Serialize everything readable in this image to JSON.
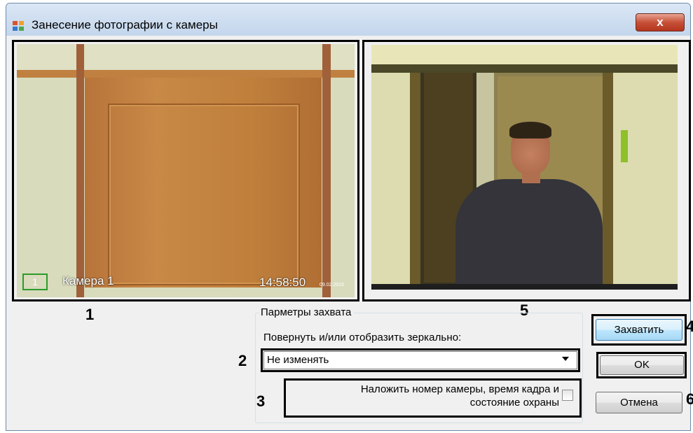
{
  "page": {
    "caption_fragment": ""
  },
  "window": {
    "title": "Занесение фотографии с камеры",
    "close_label": "x"
  },
  "left_camera": {
    "number": "1",
    "name": "Камера 1",
    "time": "14:58:50",
    "date": "09.02.2015"
  },
  "callouts": {
    "n1": "1",
    "n2": "2",
    "n3": "3",
    "n4": "4",
    "n5": "5",
    "n6": "6"
  },
  "capture_params": {
    "title": "Парметры захвата",
    "rotate_label": "Повернуть и/или отобразить зеркально:",
    "rotate_value": "Не изменять",
    "overlay_label_line1": "Наложить номер камеры, время кадра и",
    "overlay_label_line2": "состояние охраны",
    "overlay_checked": false
  },
  "buttons": {
    "capture": "Захватить",
    "ok": "OK",
    "cancel": "Отмена"
  },
  "colors": {
    "title_bar": "#c4d6ec",
    "close_button": "#c75038",
    "highlight_border": "#000000",
    "osd_box": "#2c9b2c"
  }
}
